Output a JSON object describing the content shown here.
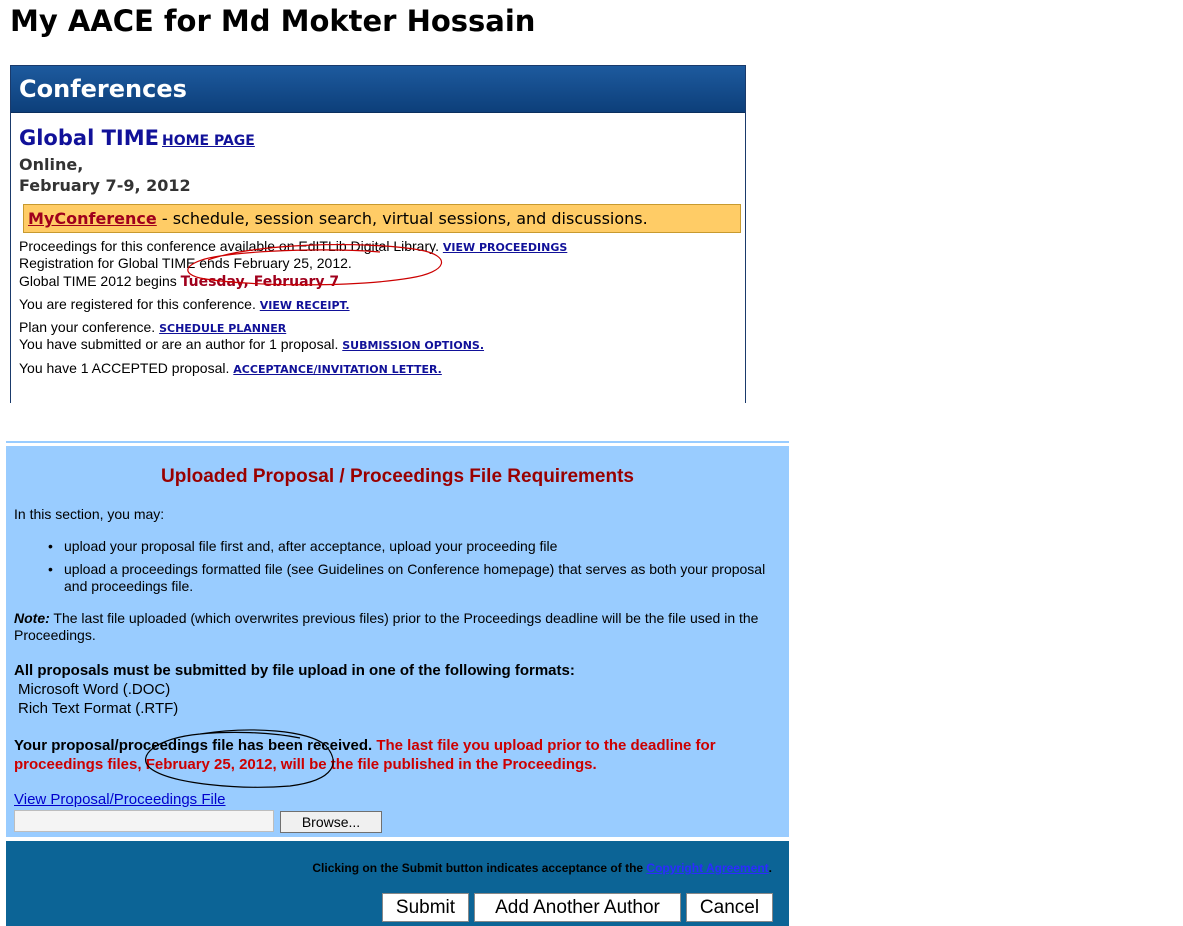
{
  "page_title": "My AACE for Md Mokter Hossain",
  "conference": {
    "header": "Conferences",
    "name": "Global TIME",
    "home_link": "HOME PAGE",
    "location": "Online,",
    "dates": "February 7-9, 2012",
    "myconf": {
      "link": "MyConference",
      "description": " - schedule, session search, virtual sessions, and discussions."
    },
    "proceedings_text": "Proceedings for this conference available on EdITLib Digital Library.",
    "proceedings_link": "VIEW PROCEEDINGS",
    "registration_text": "Registration for Global TIME ends February 25, 2012.",
    "begins_text": "Global TIME 2012 begins",
    "begins_date": "Tuesday, February 7",
    "registered_text": "You are registered for this conference.",
    "receipt_link": "VIEW RECEIPT.",
    "plan_text": "Plan your conference.",
    "planner_link": "SCHEDULE PLANNER",
    "submitted_text": "You have submitted or are an author for 1 proposal.",
    "submission_link": "SUBMISSION OPTIONS.",
    "accepted_text": "You have 1 ACCEPTED proposal.",
    "acceptance_link": "ACCEPTANCE/INVITATION LETTER."
  },
  "requirements": {
    "title": "Uploaded Proposal / Proceedings File Requirements",
    "intro": "In this section, you may:",
    "bullets": [
      "upload your proposal file first and, after acceptance, upload your proceeding file",
      "upload a proceedings formatted file (see Guidelines on Conference homepage) that serves as both your proposal and proceedings file."
    ],
    "note_label": "Note:",
    "note_text": " The last file uploaded (which overwrites previous files) prior to the Proceedings deadline will be the file used in the Proceedings.",
    "formats_heading": "All proposals must be submitted by file upload in one of the following formats:",
    "formats": [
      "Microsoft Word (.DOC)",
      "Rich Text Format (.RTF)"
    ],
    "received_text": "Your proposal/proceedings file has been received.",
    "deadline_text": "The last file you upload prior to the deadline for proceedings files, February 25, 2012, will be the file published in the Proceedings.",
    "view_link": "View Proposal/Proceedings File",
    "browse_label": "Browse..."
  },
  "submit_section": {
    "copyright_text": "Clicking on the Submit button indicates acceptance of the",
    "copyright_link": "Copyright Agreement",
    "copyright_end": ".",
    "submit_label": "Submit",
    "add_author_label": "Add Another Author",
    "cancel_label": "Cancel"
  },
  "colors": {
    "header_blue": "#0d3f7a",
    "link_blue": "#111199",
    "myconf_bar": "#ffcc66",
    "dark_red": "#a0001c",
    "panel_blue": "#99ccff",
    "submit_bar": "#0c6496",
    "annotation_red": "#cc0000",
    "annotation_black": "#000000"
  }
}
